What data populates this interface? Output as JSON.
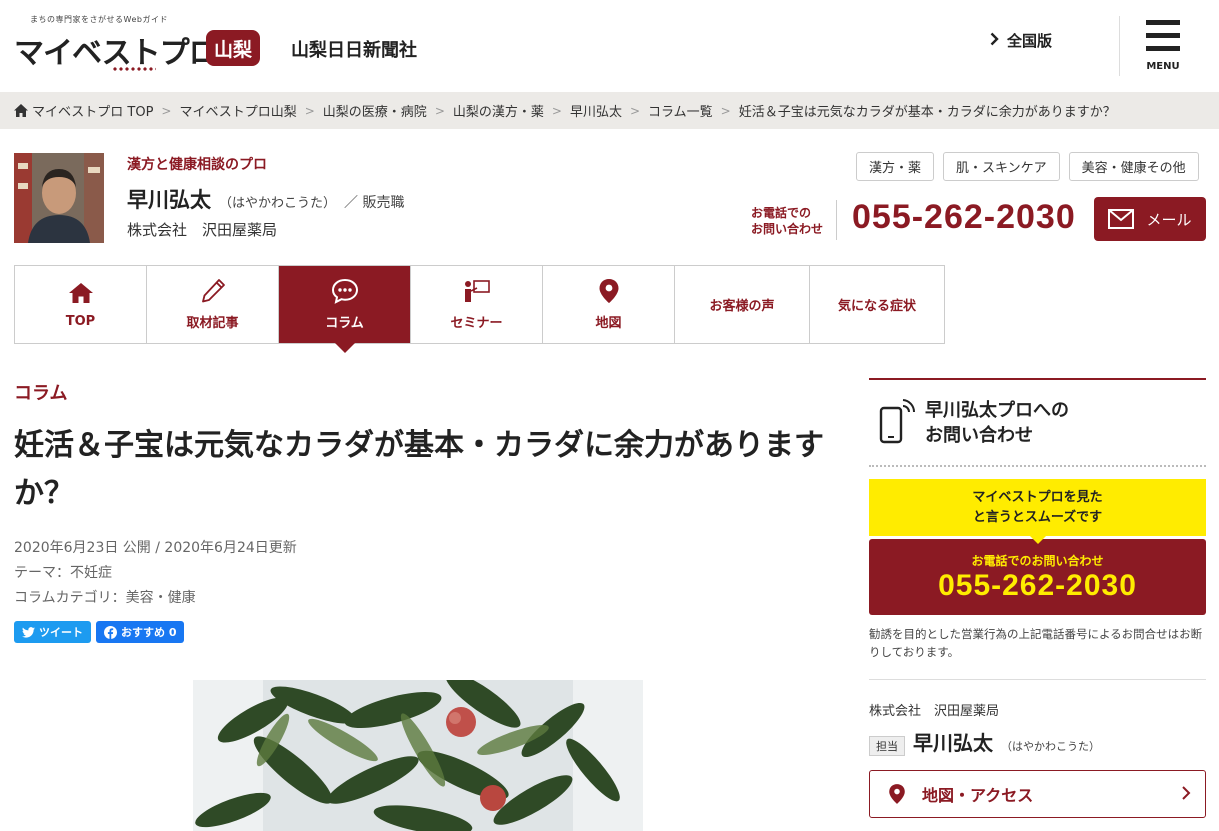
{
  "header": {
    "logo_tagline": "まちの専門家をさがせるWebガイド",
    "logo_text": "マイベストプロ",
    "prefecture_badge": "山梨",
    "newspaper": "山梨日日新聞社",
    "national_link": "全国版",
    "menu_label": "MENU"
  },
  "breadcrumb": [
    "マイベストプロ TOP",
    "マイベストプロ山梨",
    "山梨の医療・病院",
    "山梨の漢方・薬",
    "早川弘太",
    "コラム一覧",
    "妊活＆子宝は元気なカラダが基本・カラダに余力がありますか？"
  ],
  "profile": {
    "category": "漢方と健康相談のプロ",
    "name": "早川弘太",
    "kana": "（はやかわこうた）",
    "job": "／ 販売職",
    "company": "株式会社　沢田屋薬局",
    "tags": [
      "漢方・薬",
      "肌・スキンケア",
      "美容・健康その他"
    ],
    "tel_label_1": "お電話での",
    "tel_label_2": "お問い合わせ",
    "tel": "055-262-2030",
    "mail_label": "メール"
  },
  "nav": [
    {
      "label": "TOP",
      "icon": "home-icon"
    },
    {
      "label": "取材記事",
      "icon": "pencil-icon"
    },
    {
      "label": "コラム",
      "icon": "speech-bubble-icon"
    },
    {
      "label": "セミナー",
      "icon": "seminar-icon"
    },
    {
      "label": "地図",
      "icon": "map-pin-icon"
    },
    {
      "label": "お客様の声",
      "icon": ""
    },
    {
      "label": "気になる症状",
      "icon": ""
    }
  ],
  "article": {
    "section": "コラム",
    "title": "妊活＆子宝は元気なカラダが基本・カラダに余力がありますか？",
    "dates": "2020年6月23日 公開 / 2020年6月24日更新",
    "theme": "テーマ：不妊症",
    "category": "コラムカテゴリ：美容・健康",
    "tweet_label": "ツイート",
    "fb_label": "おすすめ 0"
  },
  "sidebar": {
    "contact_title_1": "早川弘太プロへの",
    "contact_title_2": "お問い合わせ",
    "promo_1": "マイベストプロを見た",
    "promo_2": "と言うとスムーズです",
    "tel_label": "お電話でのお問い合わせ",
    "tel": "055-262-2030",
    "note": "勧誘を目的とした営業行為の上記電話番号によるお問合せはお断りしております。",
    "company": "株式会社　沢田屋薬局",
    "staff_badge": "担当",
    "staff_name": "早川弘太",
    "staff_kana": "（はやかわこうた）",
    "map_label": "地図・アクセス"
  },
  "colors": {
    "brand": "#8b1a23",
    "highlight": "#ffec00",
    "twitter": "#1d9bf0",
    "facebook": "#1877f2"
  }
}
